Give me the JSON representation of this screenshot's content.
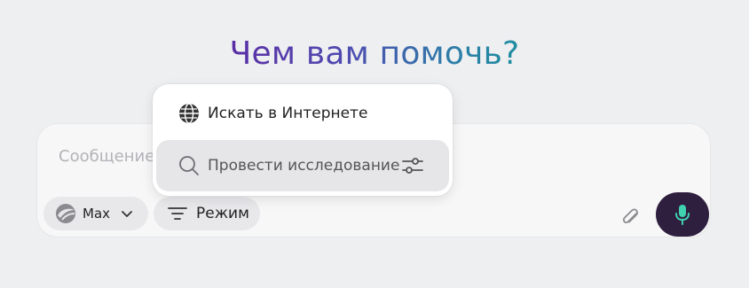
{
  "heading": {
    "text": "Чем вам помочь?"
  },
  "composer": {
    "placeholder": "Сообщение",
    "model_label": "Max",
    "mode_label": "Режим"
  },
  "mode_menu": {
    "items": [
      {
        "label": "Искать в Интернете",
        "icon": "globe-icon"
      },
      {
        "label": "Провести исследование",
        "icon": "search-icon",
        "secondary_icon": "sliders-icon"
      }
    ]
  },
  "colors": {
    "background": "#eeeff1",
    "heading_gradient_start": "#5a2ea6",
    "heading_gradient_end": "#1f8ea0",
    "mic_button": "#2f1f3f",
    "mic_icon": "#3fd1b0"
  }
}
